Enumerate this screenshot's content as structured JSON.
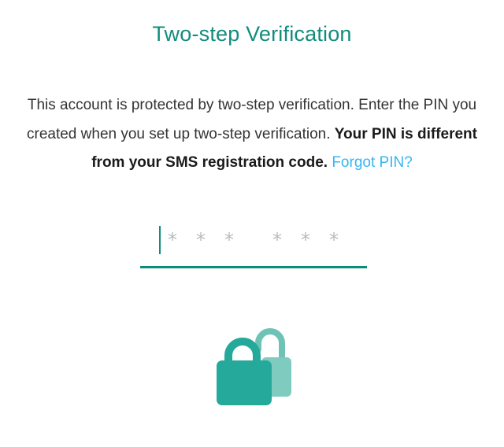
{
  "title": "Two-step Verification",
  "description": {
    "text_normal": "This account is protected by two-step verification. Enter the PIN you created when you set up two-step verification. ",
    "text_bold": "Your PIN is different from your SMS registration code.",
    "link_label": "Forgot PIN?"
  },
  "pin_input": {
    "placeholder_digits": [
      "*",
      "*",
      "*",
      "*",
      "*",
      "*"
    ],
    "value": ""
  },
  "icons": {
    "lock": "lock-icon"
  },
  "colors": {
    "accent": "#128C7E",
    "link": "#34B7F1",
    "text": "#333333",
    "placeholder": "#b8bcbc"
  }
}
